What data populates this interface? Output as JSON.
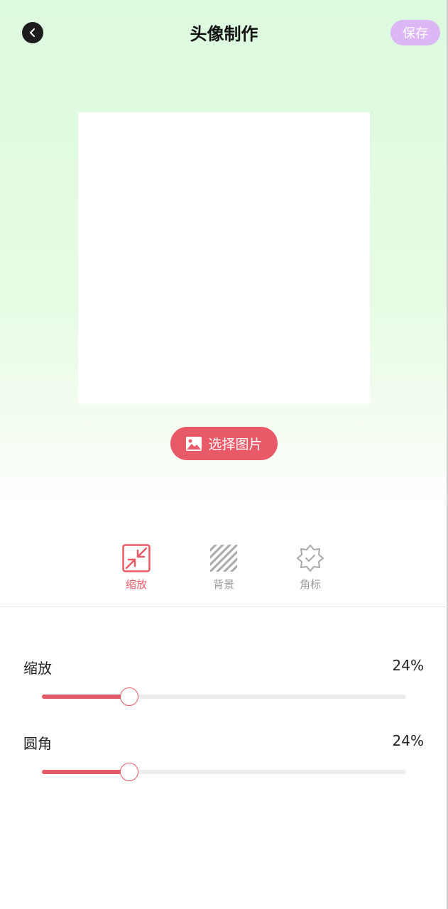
{
  "header": {
    "title": "头像制作",
    "save_label": "保存",
    "back_icon": "chevron-left-icon"
  },
  "editor": {
    "choose_image_label": "选择图片",
    "choose_image_icon": "image-icon"
  },
  "tabs": [
    {
      "label": "缩放",
      "icon": "shrink-arrows-icon",
      "active": true
    },
    {
      "label": "背景",
      "icon": "stripes-icon",
      "active": false
    },
    {
      "label": "角标",
      "icon": "badge-check-icon",
      "active": false
    }
  ],
  "sliders": [
    {
      "label": "缩放",
      "value_text": "24%",
      "value": 0.24
    },
    {
      "label": "圆角",
      "value_text": "24%",
      "value": 0.24
    }
  ],
  "colors": {
    "accent": "#e85a67",
    "save_button": "#dcb7f5",
    "header_gradient_top": "#dcfae0"
  }
}
